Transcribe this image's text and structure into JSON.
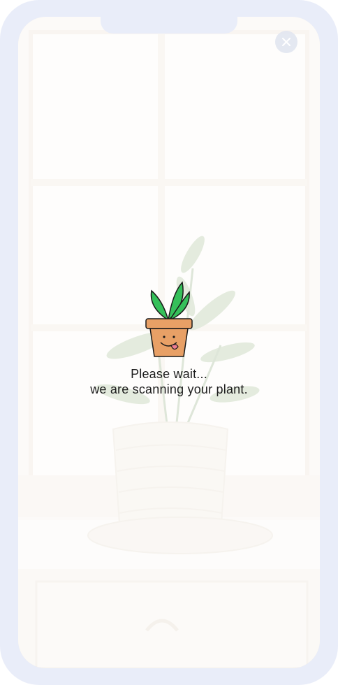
{
  "loading": {
    "line1": "Please wait...",
    "line2": "we are scanning your plant."
  },
  "colors": {
    "frame": "#e9edf9",
    "pot": "#e8a066",
    "leaves": "#35c05a",
    "text": "#1d1d1d"
  },
  "icons": {
    "close": "close-icon",
    "mascot": "plant-pot-icon"
  }
}
